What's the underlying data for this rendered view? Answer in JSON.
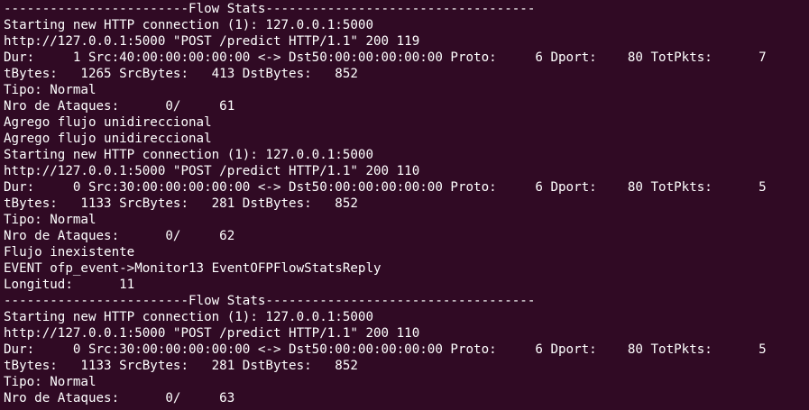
{
  "terminal": {
    "background": "#300a24",
    "foreground": "#ffffff",
    "lines": [
      "------------------------Flow Stats-----------------------------------",
      "Starting new HTTP connection (1): 127.0.0.1:5000",
      "http://127.0.0.1:5000 \"POST /predict HTTP/1.1\" 200 119",
      "Dur:     1 Src:40:00:00:00:00:00 <-> Dst50:00:00:00:00:00 Proto:     6 Dport:    80 TotPkts:      7",
      "tBytes:   1265 SrcBytes:   413 DstBytes:   852",
      "Tipo: Normal",
      "Nro de Ataques:      0/     61",
      "Agrego flujo unidireccional",
      "Agrego flujo unidireccional",
      "Starting new HTTP connection (1): 127.0.0.1:5000",
      "http://127.0.0.1:5000 \"POST /predict HTTP/1.1\" 200 110",
      "Dur:     0 Src:30:00:00:00:00:00 <-> Dst50:00:00:00:00:00 Proto:     6 Dport:    80 TotPkts:      5",
      "tBytes:   1133 SrcBytes:   281 DstBytes:   852",
      "Tipo: Normal",
      "Nro de Ataques:      0/     62",
      "Flujo inexistente",
      "EVENT ofp_event->Monitor13 EventOFPFlowStatsReply",
      "Longitud:      11",
      "------------------------Flow Stats-----------------------------------",
      "Starting new HTTP connection (1): 127.0.0.1:5000",
      "http://127.0.0.1:5000 \"POST /predict HTTP/1.1\" 200 110",
      "Dur:     0 Src:30:00:00:00:00:00 <-> Dst50:00:00:00:00:00 Proto:     6 Dport:    80 TotPkts:      5",
      "tBytes:   1133 SrcBytes:   281 DstBytes:   852",
      "Tipo: Normal",
      "Nro de Ataques:      0/     63"
    ]
  }
}
